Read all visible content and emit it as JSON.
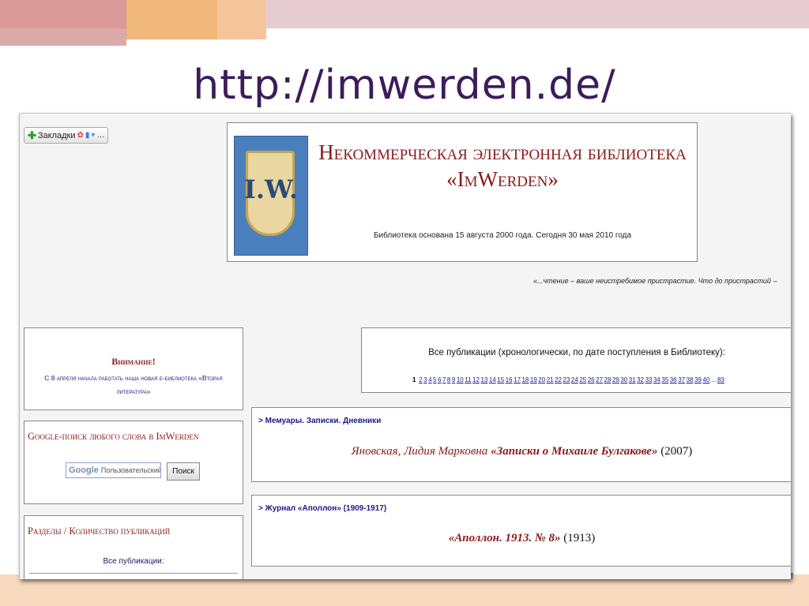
{
  "slide": {
    "title": "http://imwerden.de/"
  },
  "browser": {
    "bookmarks_button": "Закладки"
  },
  "banner": {
    "title_line1": "Некоммерческая электронная библиотека",
    "title_line2": "«ImWerden»",
    "logo_text": "I.W.",
    "subtitle": "Библиотека основана 15 августа 2000 года. Сегодня 30 мая 2010 года"
  },
  "quote": "«...чтение – ваше неистребимое пристрастие. Что до пристрастий –",
  "attention": {
    "heading": "Внимание!",
    "text": "С 8 апреля начала работать наша новая е-библиотека «Вторая литература»"
  },
  "google_search": {
    "heading": "Google-поиск любого слова в ImWerden",
    "logo": "Google",
    "placeholder": "Пользовательский",
    "button": "Поиск"
  },
  "sections": {
    "heading": "Разделы / Количество публикаций",
    "all": "Все публикации:"
  },
  "publications": {
    "heading": "Все публикации (хронологически, по дате поступления в Библиотеку):",
    "current_page": "1",
    "pages": [
      "2",
      "3",
      "4",
      "5",
      "6",
      "7",
      "8",
      "9",
      "10",
      "11",
      "12",
      "13",
      "14",
      "15",
      "16",
      "17",
      "18",
      "19",
      "20",
      "21",
      "22",
      "23",
      "24",
      "25",
      "26",
      "27",
      "28",
      "29",
      "30",
      "31",
      "32",
      "33",
      "34",
      "35",
      "36",
      "37",
      "38",
      "39",
      "40"
    ],
    "ellipsis": "...",
    "last_page": "83"
  },
  "entries": [
    {
      "category": "> Мемуары. Записки. Дневники",
      "author": "Яновская, Лидия Марковна",
      "work": "«Записки о Михаиле Булгакове»",
      "year": "(2007)"
    },
    {
      "category": "> Журнал «Аполлон» (1909-1917)",
      "author": "",
      "work": "«Аполлон. 1913. № 8»",
      "year": "(1913)"
    }
  ]
}
